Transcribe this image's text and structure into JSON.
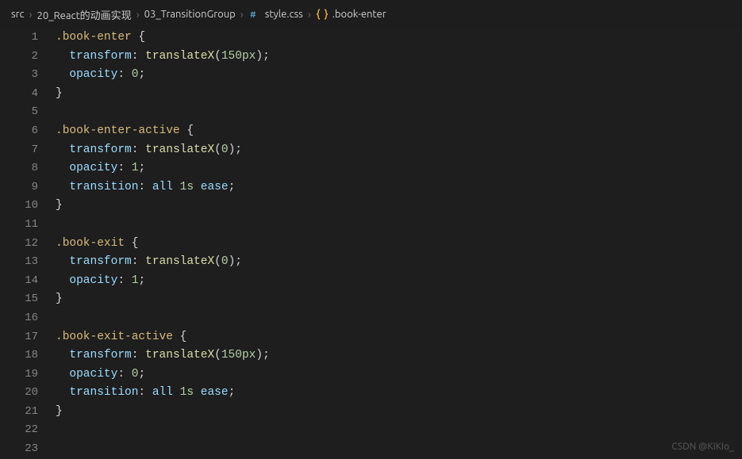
{
  "breadcrumb": {
    "items": [
      {
        "label": "src"
      },
      {
        "label": "20_React的动画实现"
      },
      {
        "label": "03_TransitionGroup"
      },
      {
        "label": "style.css",
        "icon": "css"
      },
      {
        "label": ".book-enter",
        "icon": "symbol"
      }
    ],
    "sep": "›"
  },
  "gutter": {
    "start": 1,
    "end": 23
  },
  "code_lines": [
    {
      "n": 1,
      "parts": [
        {
          "t": ".book-enter",
          "c": "tok-sel"
        },
        {
          "t": " "
        },
        {
          "t": "{",
          "c": "tok-br"
        }
      ]
    },
    {
      "n": 2,
      "indent": 1,
      "parts": [
        {
          "t": "transform",
          "c": "tok-prop"
        },
        {
          "t": ": ",
          "c": "tok-col"
        },
        {
          "t": "translateX",
          "c": "tok-func"
        },
        {
          "t": "(",
          "c": "tok-pn"
        },
        {
          "t": "150px",
          "c": "tok-num"
        },
        {
          "t": ")",
          "c": "tok-pn"
        },
        {
          "t": ";",
          "c": "tok-col"
        }
      ]
    },
    {
      "n": 3,
      "indent": 1,
      "parts": [
        {
          "t": "opacity",
          "c": "tok-prop"
        },
        {
          "t": ": ",
          "c": "tok-col"
        },
        {
          "t": "0",
          "c": "tok-num"
        },
        {
          "t": ";",
          "c": "tok-col"
        }
      ]
    },
    {
      "n": 4,
      "parts": [
        {
          "t": "}",
          "c": "tok-br"
        }
      ]
    },
    {
      "n": 5,
      "parts": []
    },
    {
      "n": 6,
      "parts": [
        {
          "t": ".book-enter-active",
          "c": "tok-sel"
        },
        {
          "t": " "
        },
        {
          "t": "{",
          "c": "tok-br"
        }
      ]
    },
    {
      "n": 7,
      "indent": 1,
      "parts": [
        {
          "t": "transform",
          "c": "tok-prop"
        },
        {
          "t": ": ",
          "c": "tok-col"
        },
        {
          "t": "translateX",
          "c": "tok-func"
        },
        {
          "t": "(",
          "c": "tok-pn"
        },
        {
          "t": "0",
          "c": "tok-num"
        },
        {
          "t": ")",
          "c": "tok-pn"
        },
        {
          "t": ";",
          "c": "tok-col"
        }
      ]
    },
    {
      "n": 8,
      "indent": 1,
      "parts": [
        {
          "t": "opacity",
          "c": "tok-prop"
        },
        {
          "t": ": ",
          "c": "tok-col"
        },
        {
          "t": "1",
          "c": "tok-num"
        },
        {
          "t": ";",
          "c": "tok-col"
        }
      ]
    },
    {
      "n": 9,
      "indent": 1,
      "parts": [
        {
          "t": "transition",
          "c": "tok-prop"
        },
        {
          "t": ": ",
          "c": "tok-col"
        },
        {
          "t": "all ",
          "c": "tok-kw"
        },
        {
          "t": "1s",
          "c": "tok-num"
        },
        {
          "t": " "
        },
        {
          "t": "ease",
          "c": "tok-kw"
        },
        {
          "t": ";",
          "c": "tok-col"
        }
      ]
    },
    {
      "n": 10,
      "parts": [
        {
          "t": "}",
          "c": "tok-br"
        }
      ]
    },
    {
      "n": 11,
      "parts": []
    },
    {
      "n": 12,
      "parts": [
        {
          "t": ".book-exit",
          "c": "tok-sel"
        },
        {
          "t": " "
        },
        {
          "t": "{",
          "c": "tok-br"
        }
      ]
    },
    {
      "n": 13,
      "indent": 1,
      "parts": [
        {
          "t": "transform",
          "c": "tok-prop"
        },
        {
          "t": ": ",
          "c": "tok-col"
        },
        {
          "t": "translateX",
          "c": "tok-func"
        },
        {
          "t": "(",
          "c": "tok-pn"
        },
        {
          "t": "0",
          "c": "tok-num"
        },
        {
          "t": ")",
          "c": "tok-pn"
        },
        {
          "t": ";",
          "c": "tok-col"
        }
      ]
    },
    {
      "n": 14,
      "indent": 1,
      "parts": [
        {
          "t": "opacity",
          "c": "tok-prop"
        },
        {
          "t": ": ",
          "c": "tok-col"
        },
        {
          "t": "1",
          "c": "tok-num"
        },
        {
          "t": ";",
          "c": "tok-col"
        }
      ]
    },
    {
      "n": 15,
      "parts": [
        {
          "t": "}",
          "c": "tok-br"
        }
      ]
    },
    {
      "n": 16,
      "parts": []
    },
    {
      "n": 17,
      "parts": [
        {
          "t": ".book-exit-active",
          "c": "tok-sel"
        },
        {
          "t": " "
        },
        {
          "t": "{",
          "c": "tok-br"
        }
      ]
    },
    {
      "n": 18,
      "indent": 1,
      "parts": [
        {
          "t": "transform",
          "c": "tok-prop"
        },
        {
          "t": ": ",
          "c": "tok-col"
        },
        {
          "t": "translateX",
          "c": "tok-func"
        },
        {
          "t": "(",
          "c": "tok-pn"
        },
        {
          "t": "150px",
          "c": "tok-num"
        },
        {
          "t": ")",
          "c": "tok-pn"
        },
        {
          "t": ";",
          "c": "tok-col"
        }
      ]
    },
    {
      "n": 19,
      "indent": 1,
      "parts": [
        {
          "t": "opacity",
          "c": "tok-prop"
        },
        {
          "t": ": ",
          "c": "tok-col"
        },
        {
          "t": "0",
          "c": "tok-num"
        },
        {
          "t": ";",
          "c": "tok-col"
        }
      ]
    },
    {
      "n": 20,
      "indent": 1,
      "parts": [
        {
          "t": "transition",
          "c": "tok-prop"
        },
        {
          "t": ": ",
          "c": "tok-col"
        },
        {
          "t": "all ",
          "c": "tok-kw"
        },
        {
          "t": "1s",
          "c": "tok-num"
        },
        {
          "t": " "
        },
        {
          "t": "ease",
          "c": "tok-kw"
        },
        {
          "t": ";",
          "c": "tok-col"
        }
      ]
    },
    {
      "n": 21,
      "parts": [
        {
          "t": "}",
          "c": "tok-br"
        }
      ]
    },
    {
      "n": 22,
      "parts": []
    },
    {
      "n": 23,
      "parts": []
    }
  ],
  "watermark": "CSDN @KIKIo_"
}
